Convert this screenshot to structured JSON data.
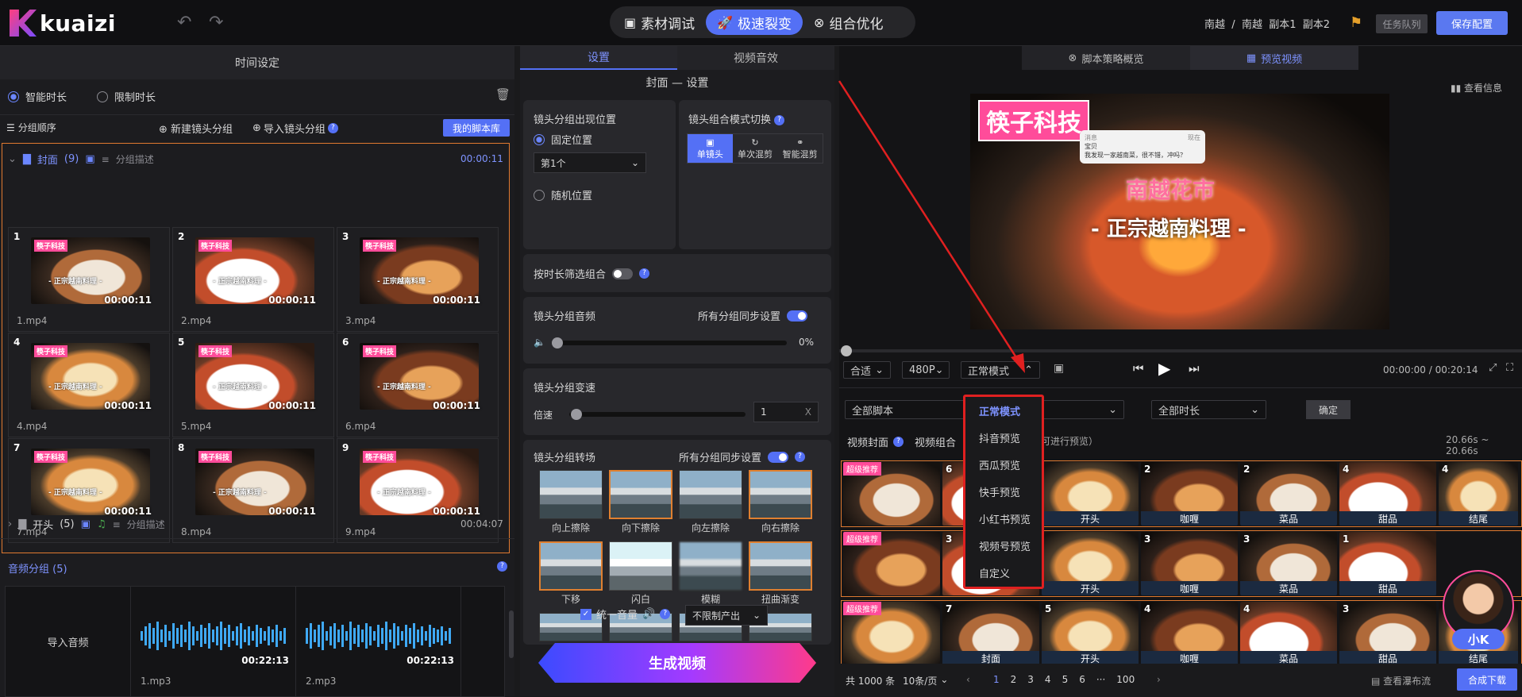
{
  "app": {
    "brand": "kuaizi"
  },
  "topbar": {
    "modes": [
      {
        "label": "素材调试",
        "icon": "film-icon"
      },
      {
        "label": "极速裂变",
        "icon": "rocket-icon"
      },
      {
        "label": "组合优化",
        "icon": "combine-icon"
      }
    ],
    "breadcrumb": [
      "南越",
      "南越",
      "副本1",
      "副本2"
    ],
    "queue": "任务队列",
    "save": "保存配置"
  },
  "left": {
    "title": "时间设定",
    "smart": "智能时长",
    "limit": "限制时长",
    "order": "分组顺序",
    "newGroup": "新建镜头分组",
    "importGroup": "导入镜头分组",
    "library": "我的脚本库",
    "group1": {
      "name": "封面",
      "count": "(9)",
      "desc": "分组描述",
      "dur": "00:00:11"
    },
    "clips": [
      {
        "n": "1",
        "d": "00:00:11",
        "f": "1.mp4"
      },
      {
        "n": "2",
        "d": "00:00:11",
        "f": "2.mp4"
      },
      {
        "n": "3",
        "d": "00:00:11",
        "f": "3.mp4"
      },
      {
        "n": "4",
        "d": "00:00:11",
        "f": "4.mp4"
      },
      {
        "n": "5",
        "d": "00:00:11",
        "f": "5.mp4"
      },
      {
        "n": "6",
        "d": "00:00:11",
        "f": "6.mp4"
      },
      {
        "n": "7",
        "d": "00:00:11",
        "f": "7.mp4"
      },
      {
        "n": "8",
        "d": "00:00:11",
        "f": "8.mp4"
      },
      {
        "n": "9",
        "d": "00:00:11",
        "f": "9.mp4"
      }
    ],
    "group2": {
      "name": "开头",
      "count": "(5)",
      "desc": "分组描述",
      "dur": "00:04:07"
    },
    "audio": {
      "title": "音频分组",
      "count": "(5)",
      "import": "导入音频",
      "files": [
        {
          "d": "00:22:13",
          "f": "1.mp3"
        },
        {
          "d": "00:22:13",
          "f": "2.mp3"
        }
      ]
    }
  },
  "mid": {
    "tabs": [
      "设置",
      "视频音效"
    ],
    "subtitle": "封面 — 设置",
    "pos": {
      "title": "镜头分组出现位置",
      "fixed": "固定位置",
      "select": "第1个",
      "random": "随机位置"
    },
    "combo": {
      "title": "镜头组合模式切换",
      "opts": [
        "单镜头",
        "单次混剪",
        "智能混剪"
      ]
    },
    "filter": "按时长筛选组合",
    "volume": {
      "title": "镜头分组音频",
      "sync": "所有分组同步设置",
      "val": "0%"
    },
    "speed": {
      "title": "镜头分组变速",
      "label": "倍速",
      "val": "1",
      "unit": "X"
    },
    "transition": {
      "title": "镜头分组转场",
      "sync": "所有分组同步设置",
      "items": [
        "向上擦除",
        "向下擦除",
        "向左擦除",
        "向右擦除",
        "下移",
        "闪白",
        "模糊",
        "扭曲渐变"
      ]
    },
    "unify": "统一音量",
    "output": "不限制产出",
    "generate": "生成视频"
  },
  "right": {
    "tabs": [
      "脚本策略概览",
      "预览视频"
    ],
    "info": "查看信息",
    "video": {
      "logo": "筷子科技",
      "title": "南越花市",
      "sub": "- 正宗越南料理 -",
      "notif_app": "消息",
      "notif_time": "现在",
      "notif_name": "宝贝",
      "notif_msg": "我发现一家越南菜，很不错，冲吗？"
    },
    "controls": {
      "fit": "合适",
      "res": "480P",
      "mode": "正常模式",
      "time": "00:00:00 / 00:20:14"
    },
    "filters": {
      "script": "全部脚本",
      "dur": "全部时长",
      "confirm": "确定"
    },
    "labels": {
      "cover": "视频封面",
      "combo": "视频组合",
      "hint": "可进行预览）",
      "range": "20.66s ~ 20.66s"
    },
    "rows": [
      {
        "badge": "超级推荐",
        "items": [
          {
            "n": "6",
            "l": ""
          },
          {
            "n": "",
            "l": "开头"
          },
          {
            "n": "2",
            "l": "咖喱"
          },
          {
            "n": "2",
            "l": "菜品"
          },
          {
            "n": "4",
            "l": "甜品"
          },
          {
            "n": "4",
            "l": "结尾"
          }
        ]
      },
      {
        "badge": "超级推荐",
        "items": [
          {
            "n": "3",
            "l": ""
          },
          {
            "n": "",
            "l": "开头"
          },
          {
            "n": "3",
            "l": "咖喱"
          },
          {
            "n": "3",
            "l": "菜品"
          },
          {
            "n": "1",
            "l": "甜品"
          },
          {
            "n": "",
            "l": ""
          }
        ]
      },
      {
        "badge": "超级推荐",
        "items": [
          {
            "n": "7",
            "l": "封面"
          },
          {
            "n": "5",
            "l": "开头"
          },
          {
            "n": "4",
            "l": "咖喱"
          },
          {
            "n": "4",
            "l": "菜品"
          },
          {
            "n": "3",
            "l": "甜品"
          },
          {
            "n": "",
            "l": "结尾"
          }
        ]
      }
    ],
    "menu": [
      "正常模式",
      "抖音预览",
      "西瓜预览",
      "快手预览",
      "小红书预览",
      "视频号预览",
      "自定义"
    ],
    "footer": {
      "total": "共 1000 条",
      "per": "10条/页",
      "pages": [
        "1",
        "2",
        "3",
        "4",
        "5",
        "6",
        "···",
        "100"
      ],
      "waterfall": "查看瀑布流",
      "download": "合成下载"
    },
    "assistant": "小K"
  }
}
